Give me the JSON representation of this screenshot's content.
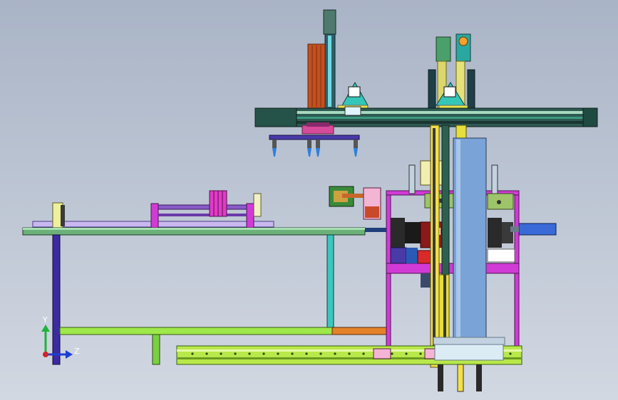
{
  "viewport": {
    "background_top": "#a9b4c6",
    "background_bottom": "#d2d8e2"
  },
  "triad": {
    "y_label": "Y",
    "z_label": "Z",
    "y_color": "#1fb33a",
    "z_color": "#1a3fd6",
    "x_color": "#d2232a"
  },
  "parts": {
    "colors": {
      "frame_magenta": "#d23ad6",
      "beam_dark": "#2d5a52",
      "rail_green": "#b8e84a",
      "column_blue": "#7aa3d8",
      "cylinder_orange": "#c8662c",
      "table_top": "#6cb07a",
      "conveyor_lilac": "#c9b8f0"
    },
    "icons": [
      "manipulator-icon",
      "gripper-icon",
      "cylinder-icon",
      "motor-icon"
    ]
  }
}
